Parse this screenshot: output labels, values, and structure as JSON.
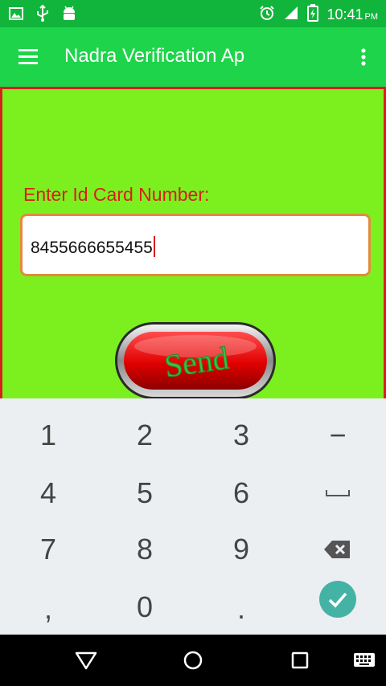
{
  "status_bar": {
    "time": "10:41",
    "ampm": "PM",
    "icons": [
      "image-notification-icon",
      "usb-icon",
      "android-debug-icon",
      "alarm-icon",
      "signal-icon",
      "battery-charging-icon"
    ]
  },
  "app_bar": {
    "title": "Nadra Verification Ap",
    "menu_icon": "hamburger-menu-icon",
    "overflow_icon": "more-vert-icon"
  },
  "form": {
    "label": "Enter Id Card Number:",
    "id_value": "8455666655455",
    "send_label": "Send"
  },
  "colors": {
    "status_bar": "#11b53b",
    "app_bar": "#1ed44a",
    "content_bg": "#7cf01e",
    "border_red": "#d81e1e",
    "input_border": "#e38a3c",
    "keyboard_bg": "#eceff1",
    "done_button": "#44b3a6"
  },
  "keyboard": {
    "keys": [
      "1",
      "2",
      "3",
      "−",
      "4",
      "5",
      "6",
      "space",
      "7",
      "8",
      "9",
      "backspace",
      ",",
      "0",
      ".",
      "done"
    ],
    "labels": {
      "k1": "1",
      "k2": "2",
      "k3": "3",
      "minus": "−",
      "k4": "4",
      "k5": "5",
      "k6": "6",
      "k7": "7",
      "k8": "8",
      "k9": "9",
      "comma": ",",
      "k0": "0",
      "period": "."
    }
  },
  "nav_bar": {
    "buttons": [
      "back-icon",
      "home-icon",
      "recents-icon",
      "keyboard-switch-icon"
    ]
  }
}
